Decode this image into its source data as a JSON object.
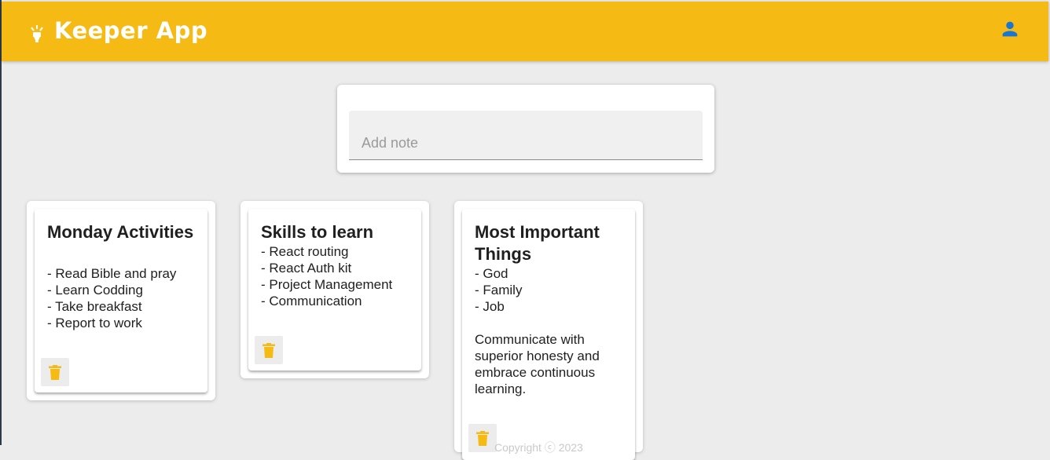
{
  "app": {
    "title": "Keeper App"
  },
  "header": {
    "logo_icon": "lightbulb-icon",
    "user_icon": "account-icon",
    "accent_color": "#f5ba13"
  },
  "add_note": {
    "placeholder": "Add note",
    "value": ""
  },
  "notes": [
    {
      "title": "Monday Activities",
      "content": "- Read Bible and pray\n- Learn Codding\n- Take breakfast\n- Report to work"
    },
    {
      "title": "Skills to learn",
      "content": "- React routing\n- React Auth kit\n- Project Management\n- Communication"
    },
    {
      "title": "Most Important Things",
      "content": "- God\n- Family\n- Job\n\nCommunicate with superior honesty and embrace continuous learning."
    }
  ],
  "delete_icon": "delete-icon",
  "footer": {
    "text": "Copyright ⓒ 2023"
  }
}
